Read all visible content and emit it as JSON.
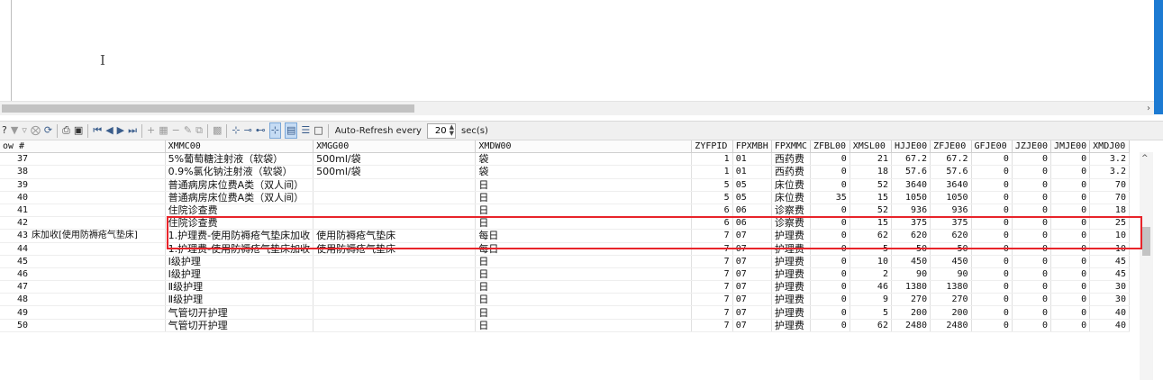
{
  "editor": {
    "cursor_glyph": "I"
  },
  "toolbar": {
    "icons": [
      "help-icon",
      "filter-icon",
      "filter-clear-icon",
      "stop-icon",
      "refresh-icon",
      "print-icon",
      "save-icon",
      "first-record-icon",
      "prev-record-icon",
      "next-record-icon",
      "last-record-icon",
      "insert-record-icon",
      "grid-icon",
      "delete-record-icon",
      "edit-record-icon",
      "copy-record-icon",
      "form-view-icon",
      "default-icon",
      "set-null-icon",
      "not-null-icon",
      "not-null-default-icon",
      "grid-view-icon",
      "form-layout-icon",
      "text-view-icon"
    ],
    "auto_refresh_label": "Auto-Refresh every",
    "auto_refresh_value": "20",
    "auto_refresh_unit": "sec(s)"
  },
  "grid": {
    "columns": [
      "ow #",
      "",
      "XMMC00",
      "XMGG00",
      "XMDW00",
      "ZYFPID",
      "FPXMBH",
      "FPXMMC",
      "ZFBL00",
      "XMSL00",
      "HJJE00",
      "ZFJE00",
      "GFJE00",
      "JZJE00",
      "JMJE00",
      "XMDJ00"
    ],
    "rows": [
      {
        "rn": "37",
        "pre": "",
        "name": "5%葡萄糖注射液（软袋）",
        "spec": "500ml/袋",
        "unit": "袋",
        "fpid": "1",
        "fpbh": "01",
        "fpmc": "西药费",
        "zfbl": "0",
        "sl": "21",
        "hj": "67.2",
        "zf": "67.2",
        "gf": "0",
        "jz": "0",
        "jm": "0",
        "dj": "3.2"
      },
      {
        "rn": "38",
        "pre": "",
        "name": "0.9%氯化钠注射液（软袋）",
        "spec": "500ml/袋",
        "unit": "袋",
        "fpid": "1",
        "fpbh": "01",
        "fpmc": "西药费",
        "zfbl": "0",
        "sl": "18",
        "hj": "57.6",
        "zf": "57.6",
        "gf": "0",
        "jz": "0",
        "jm": "0",
        "dj": "3.2"
      },
      {
        "rn": "39",
        "pre": "",
        "name": "普通病房床位费A类（双人间）",
        "spec": "",
        "unit": "日",
        "fpid": "5",
        "fpbh": "05",
        "fpmc": "床位费",
        "zfbl": "0",
        "sl": "52",
        "hj": "3640",
        "zf": "3640",
        "gf": "0",
        "jz": "0",
        "jm": "0",
        "dj": "70"
      },
      {
        "rn": "40",
        "pre": "",
        "name": "普通病房床位费A类（双人间）",
        "spec": "",
        "unit": "日",
        "fpid": "5",
        "fpbh": "05",
        "fpmc": "床位费",
        "zfbl": "35",
        "sl": "15",
        "hj": "1050",
        "zf": "1050",
        "gf": "0",
        "jz": "0",
        "jm": "0",
        "dj": "70"
      },
      {
        "rn": "41",
        "pre": "",
        "name": "住院诊查费",
        "spec": "",
        "unit": "日",
        "fpid": "6",
        "fpbh": "06",
        "fpmc": "诊察费",
        "zfbl": "0",
        "sl": "52",
        "hj": "936",
        "zf": "936",
        "gf": "0",
        "jz": "0",
        "jm": "0",
        "dj": "18"
      },
      {
        "rn": "42",
        "pre": "",
        "name": "住院诊查费",
        "spec": "",
        "unit": "日",
        "fpid": "6",
        "fpbh": "06",
        "fpmc": "诊察费",
        "zfbl": "0",
        "sl": "15",
        "hj": "375",
        "zf": "375",
        "gf": "0",
        "jz": "0",
        "jm": "0",
        "dj": "25"
      },
      {
        "rn": "43",
        "pre": "床加收[使用防褥疮气垫床]",
        "name": "1.护理费-使用防褥疮气垫床加收",
        "spec": "使用防褥疮气垫床",
        "unit": "每日",
        "fpid": "7",
        "fpbh": "07",
        "fpmc": "护理费",
        "zfbl": "0",
        "sl": "62",
        "hj": "620",
        "zf": "620",
        "gf": "0",
        "jz": "0",
        "jm": "0",
        "dj": "10"
      },
      {
        "rn": "44",
        "pre": "",
        "name": "1.护理费-使用防褥疮气垫床加收",
        "spec": "使用防褥疮气垫床",
        "unit": "每日",
        "fpid": "7",
        "fpbh": "07",
        "fpmc": "护理费",
        "zfbl": "0",
        "sl": "5",
        "hj": "50",
        "zf": "50",
        "gf": "0",
        "jz": "0",
        "jm": "0",
        "dj": "10"
      },
      {
        "rn": "45",
        "pre": "",
        "name": "Ⅰ级护理",
        "spec": "",
        "unit": "日",
        "fpid": "7",
        "fpbh": "07",
        "fpmc": "护理费",
        "zfbl": "0",
        "sl": "10",
        "hj": "450",
        "zf": "450",
        "gf": "0",
        "jz": "0",
        "jm": "0",
        "dj": "45"
      },
      {
        "rn": "46",
        "pre": "",
        "name": "Ⅰ级护理",
        "spec": "",
        "unit": "日",
        "fpid": "7",
        "fpbh": "07",
        "fpmc": "护理费",
        "zfbl": "0",
        "sl": "2",
        "hj": "90",
        "zf": "90",
        "gf": "0",
        "jz": "0",
        "jm": "0",
        "dj": "45"
      },
      {
        "rn": "47",
        "pre": "",
        "name": "Ⅱ级护理",
        "spec": "",
        "unit": "日",
        "fpid": "7",
        "fpbh": "07",
        "fpmc": "护理费",
        "zfbl": "0",
        "sl": "46",
        "hj": "1380",
        "zf": "1380",
        "gf": "0",
        "jz": "0",
        "jm": "0",
        "dj": "30"
      },
      {
        "rn": "48",
        "pre": "",
        "name": "Ⅱ级护理",
        "spec": "",
        "unit": "日",
        "fpid": "7",
        "fpbh": "07",
        "fpmc": "护理费",
        "zfbl": "0",
        "sl": "9",
        "hj": "270",
        "zf": "270",
        "gf": "0",
        "jz": "0",
        "jm": "0",
        "dj": "30"
      },
      {
        "rn": "49",
        "pre": "",
        "name": "气管切开护理",
        "spec": "",
        "unit": "日",
        "fpid": "7",
        "fpbh": "07",
        "fpmc": "护理费",
        "zfbl": "0",
        "sl": "5",
        "hj": "200",
        "zf": "200",
        "gf": "0",
        "jz": "0",
        "jm": "0",
        "dj": "40"
      },
      {
        "rn": "50",
        "pre": "",
        "name": "气管切开护理",
        "spec": "",
        "unit": "日",
        "fpid": "7",
        "fpbh": "07",
        "fpmc": "护理费",
        "zfbl": "0",
        "sl": "62",
        "hj": "2480",
        "zf": "2480",
        "gf": "0",
        "jz": "0",
        "jm": "0",
        "dj": "40"
      }
    ]
  },
  "annotation": {
    "highlight_color": "#e8242a",
    "highlighted_rows": [
      "41",
      "42"
    ]
  }
}
